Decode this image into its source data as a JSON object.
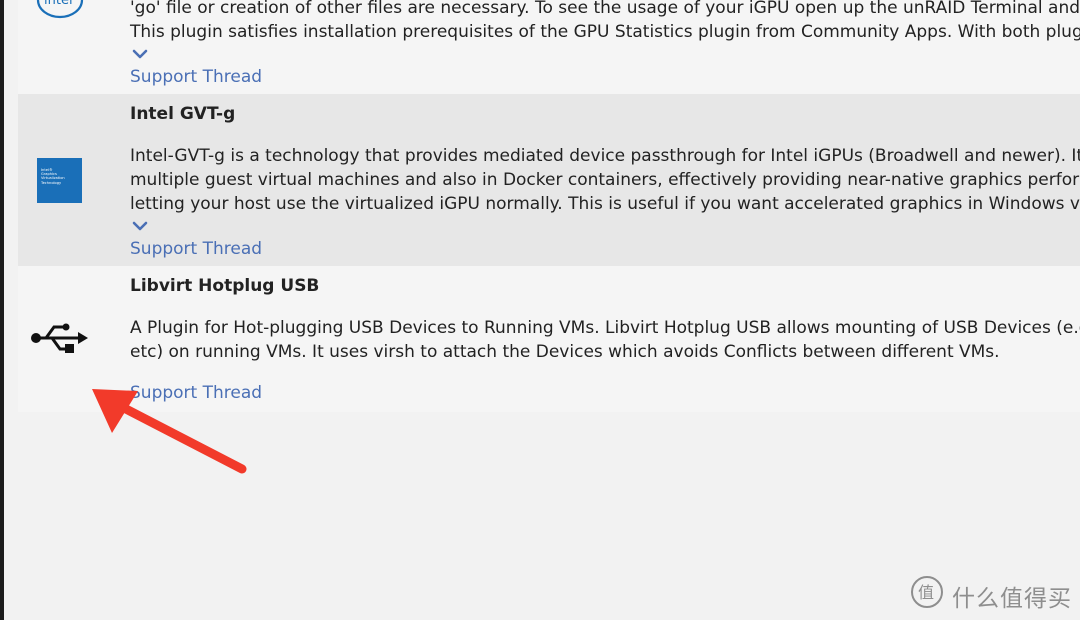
{
  "colors": {
    "link": "#4a6fb5",
    "row_alt": "#e7e7e7",
    "row": "#f5f5f5",
    "arrow": "#f23a2a",
    "gvt_icon": "#1a6fb8"
  },
  "plugins": [
    {
      "icon": "intel-logo",
      "logo_text": "intel",
      "description_lines": [
        "'go' file or creation of other files are necessary. To see the usage of your iGPU open up the unRAID Terminal and ty",
        "This plugin satisfies installation prerequisites of the GPU Statistics plugin from Community Apps. With both plug"
      ],
      "support_label": "Support Thread"
    },
    {
      "icon": "intel-gvt-icon",
      "icon_text": [
        "Intel®",
        "Graphics",
        "Virtualization",
        "Technology"
      ],
      "title": "Intel GVT-g",
      "description_lines": [
        "Intel-GVT-g is a technology that provides mediated device passthrough for Intel iGPUs (Broadwell and newer). It",
        "multiple guest virtual machines and also in Docker containers, effectively providing near-native graphics perfor",
        "letting your host use the virtualized iGPU normally. This is useful if you want accelerated graphics in Windows virtu"
      ],
      "support_label": "Support Thread"
    },
    {
      "icon": "usb-icon",
      "title": "Libvirt Hotplug USB",
      "description_lines": [
        "A Plugin for Hot-plugging USB Devices to Running VMs. Libvirt Hotplug USB allows mounting of USB Devices (e.g",
        "etc) on running VMs. It uses virsh to attach the Devices which avoids Conflicts between different VMs."
      ],
      "support_label": "Support Thread"
    }
  ],
  "watermark": {
    "text": "什么值得买",
    "icon": "zhi-logo-icon",
    "icon_glyph": "值"
  }
}
